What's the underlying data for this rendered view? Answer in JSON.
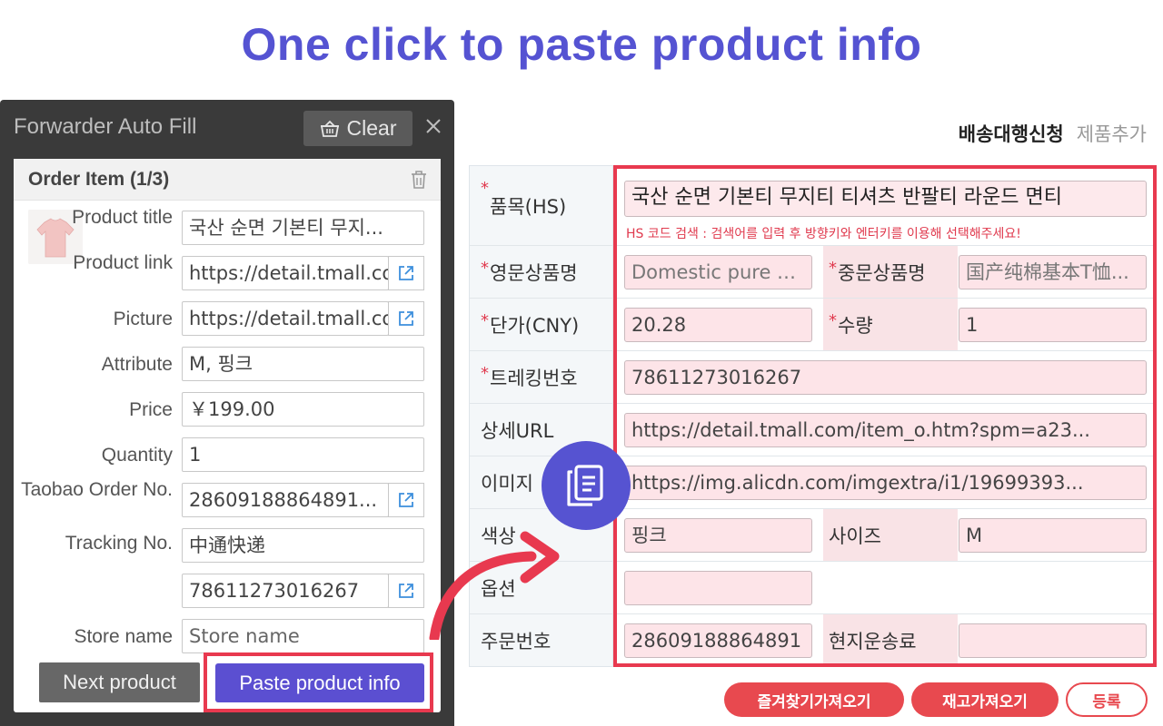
{
  "headline": "One click to paste product info",
  "tabs": {
    "active": "배송대행신청",
    "inactive": "제품추가"
  },
  "form": {
    "hs_label": "품목(HS)",
    "hs_value": "국산 순면 기본티 무지티 티셔츠 반팔티 라운드 면티",
    "hs_hint": "HS 코드 검색 : 검색어를 입력 후 방향키와 엔터키를 이용해 선택해주세요!",
    "en_name_label": "영문상품명",
    "en_name_value": "Domestic pure c...",
    "cn_name_label": "중문상품명",
    "cn_name_value": "国产纯棉基本T恤...",
    "unit_price_label": "단가(CNY)",
    "unit_price_value": "20.28",
    "qty_label": "수량",
    "qty_value": "1",
    "tracking_label": "트레킹번호",
    "tracking_value": "78611273016267",
    "detail_url_label": "상세URL",
    "detail_url_value": "https://detail.tmall.com/item_o.htm?spm=a23...",
    "image_label": "이미지",
    "image_value": "https://img.alicdn.com/imgextra/i1/19699393...",
    "color_label": "색상",
    "color_value": "핑크",
    "size_label": "사이즈",
    "size_value": "M",
    "option_label": "옵션",
    "option_value": "",
    "order_no_label": "주문번호",
    "order_no_value": "28609188864891",
    "local_shipping_label": "현지운송료",
    "local_shipping_value": ""
  },
  "actions": {
    "favorites": "즐겨찾기가져오기",
    "stock": "재고가져오기",
    "register": "등록"
  },
  "panel": {
    "title": "Forwarder Auto Fill",
    "clear": "Clear",
    "card_title": "Order Item (1/3)",
    "product_title_label": "Product title",
    "product_title_value": "국산 순면 기본티 무지...",
    "product_link_label": "Product link",
    "product_link_value": "https://detail.tmall.com",
    "picture_label": "Picture",
    "picture_value": "https://detail.tmall.com",
    "attribute_label": "Attribute",
    "attribute_value": "M, 핑크",
    "price_label": "Price",
    "price_value": "￥199.00",
    "quantity_label": "Quantity",
    "quantity_value": "1",
    "taobao_label": "Taobao Order No.",
    "taobao_value": "28609188864891...",
    "tracking_label": "Tracking No.",
    "tracking_carrier": "中通快递",
    "tracking_number": "78611273016267",
    "store_label": "Store name",
    "store_placeholder": "Store name",
    "next_button": "Next product",
    "paste_button": "Paste product info"
  },
  "colors": {
    "accent": "#5b4fd1",
    "headline": "#5553d2",
    "highlight": "#e8394f",
    "panel_bg": "#3a3a3a",
    "pink_field": "#fde4e8"
  },
  "icons": {
    "clear": "basket-icon",
    "close": "close-icon",
    "trash": "trash-icon",
    "external": "external-link-icon",
    "clipboard": "clipboard-icon"
  }
}
